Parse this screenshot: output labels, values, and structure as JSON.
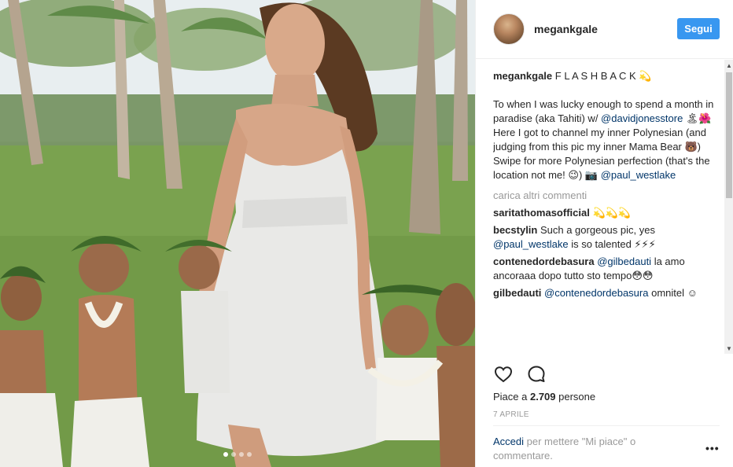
{
  "post": {
    "username": "megankgale",
    "follow_label": "Segui",
    "caption": {
      "user": "megankgale",
      "title": " F L A S H B A C K 💫",
      "line1": "To when I was lucky enough to spend a month in paradise (aka Tahiti) w/ ",
      "mention1": "@davidjonesstore",
      "line2": " 🏝🌺 Here I got to channel my inner Polynesian (and judging from this pic my inner Mama Bear 🐻) Swipe for more Polynesian perfection (that's the location not me! 😉) 📷 ",
      "mention2": "@paul_westlake"
    },
    "load_more_label": "carica altri commenti",
    "comments": [
      {
        "user": "saritathomasofficial",
        "pre": " 💫💫💫",
        "mention": "",
        "post": ""
      },
      {
        "user": "becstylin",
        "pre": " Such a gorgeous pic, yes ",
        "mention": "@paul_westlake",
        "post": " is so talented ⚡⚡⚡"
      },
      {
        "user": "contenedordebasura",
        "pre": " ",
        "mention": "@gilbedauti",
        "post": " la amo ancoraaa dopo tutto sto tempo😳😳"
      },
      {
        "user": "gilbedauti",
        "pre": " ",
        "mention": "@contenedordebasura",
        "post": " omnitel ☺"
      }
    ],
    "likes": {
      "prefix": "Piace a ",
      "count": "2.709",
      "suffix": " persone"
    },
    "date": "7 APRILE",
    "login": {
      "link": "Accedi",
      "text": " per mettere \"Mi piace\" o commentare."
    },
    "more_label": "•••",
    "icons": {
      "like": "heart-outline-icon",
      "comment": "comment-bubble-icon",
      "more": "ellipsis-icon"
    },
    "carousel": {
      "total": 4,
      "current": 1
    }
  },
  "colors": {
    "follow_button": "#3897f0",
    "link": "#003569",
    "muted": "#999999"
  }
}
